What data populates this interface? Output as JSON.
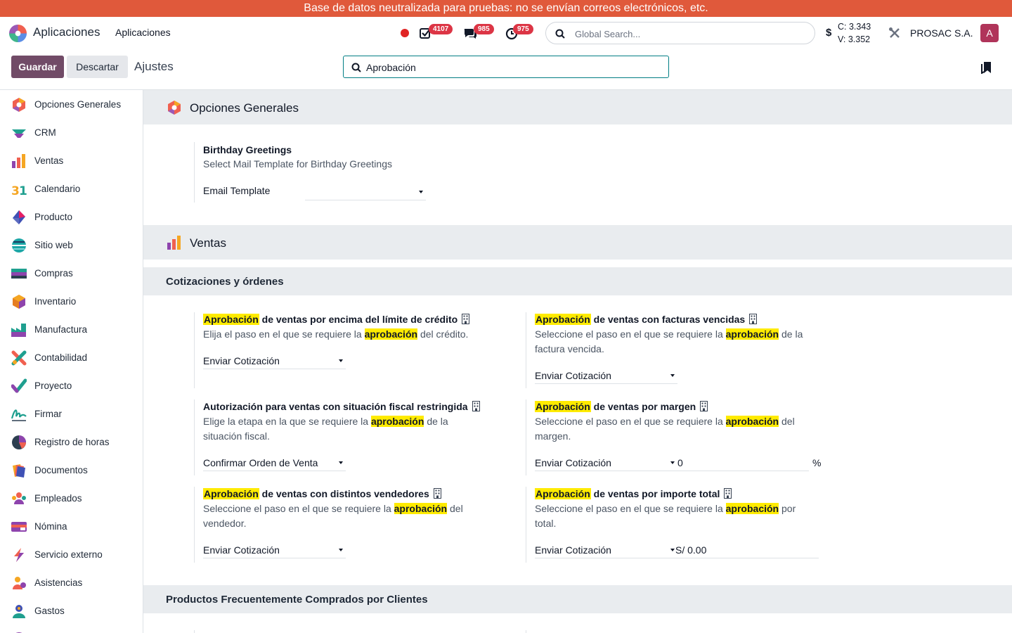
{
  "banner": {
    "text": "Base de datos neutralizada para pruebas: no se envían correos electrónicos, etc."
  },
  "navbar": {
    "app_name": "Aplicaciones",
    "menu_item": "Aplicaciones",
    "activity_badge": "4107",
    "messages_badge": "985",
    "clock_badge": "975",
    "search_placeholder": "Global Search...",
    "currency_symbol": "$",
    "rate_c": "C: 3.343",
    "rate_v": "V: 3.352",
    "company": "PROSAC S.A.",
    "avatar_letter": "A"
  },
  "control_panel": {
    "save_label": "Guardar",
    "discard_label": "Descartar",
    "title": "Ajustes",
    "search_value": "Aprobación"
  },
  "sidebar": {
    "items": [
      {
        "label": "Opciones Generales",
        "icon": "general-settings-icon"
      },
      {
        "label": "CRM",
        "icon": "crm-icon"
      },
      {
        "label": "Ventas",
        "icon": "sales-icon"
      },
      {
        "label": "Calendario",
        "icon": "calendar-icon"
      },
      {
        "label": "Producto",
        "icon": "product-icon"
      },
      {
        "label": "Sitio web",
        "icon": "website-icon"
      },
      {
        "label": "Compras",
        "icon": "purchase-icon"
      },
      {
        "label": "Inventario",
        "icon": "inventory-icon"
      },
      {
        "label": "Manufactura",
        "icon": "manufacturing-icon"
      },
      {
        "label": "Contabilidad",
        "icon": "accounting-icon"
      },
      {
        "label": "Proyecto",
        "icon": "project-icon"
      },
      {
        "label": "Firmar",
        "icon": "sign-icon"
      },
      {
        "label": "Registro de horas",
        "icon": "timesheet-icon"
      },
      {
        "label": "Documentos",
        "icon": "documents-icon"
      },
      {
        "label": "Empleados",
        "icon": "employees-icon"
      },
      {
        "label": "Nómina",
        "icon": "payroll-icon"
      },
      {
        "label": "Servicio externo",
        "icon": "field-service-icon"
      },
      {
        "label": "Asistencias",
        "icon": "attendance-icon"
      },
      {
        "label": "Gastos",
        "icon": "expenses-icon"
      }
    ]
  },
  "general": {
    "title": "Opciones Generales",
    "birthday_title": "Birthday Greetings",
    "birthday_desc": "Select Mail Template for Birthday Greetings",
    "email_template_label": "Email Template",
    "email_template_value": ""
  },
  "sales": {
    "title": "Ventas",
    "section_title": "Cotizaciones y órdenes",
    "next_section_title": "Productos Frecuentemente Comprados por Clientes",
    "hl_word": "Aprobación",
    "hl_word_lower": "aprobación",
    "credit": {
      "title_rest": "de ventas por encima del límite de crédito",
      "desc_pre": "Elija el paso en el que se requiere la",
      "desc_post": "del crédito.",
      "value": "Enviar Cotización"
    },
    "overdue": {
      "title_rest": "de ventas con facturas vencidas",
      "desc_pre": "Seleccione el paso en el que se requiere la",
      "desc_post": "de la factura vencida.",
      "value": "Enviar Cotización"
    },
    "fiscal": {
      "title": "Autorización para ventas con situación fiscal restringida",
      "desc_pre": "Elige la etapa en la que se requiere la",
      "desc_post": "de la situación fiscal.",
      "value": "Confirmar Orden de Venta"
    },
    "margin": {
      "title_rest": "de ventas por margen",
      "desc_pre": "Seleccione el paso en el que se requiere la",
      "desc_post": "del margen.",
      "value": "Enviar Cotización",
      "amount": "0",
      "unit": "%"
    },
    "sellers": {
      "title_rest": "de ventas con distintos vendedores",
      "desc_pre": "Seleccione el paso en el que se requiere la",
      "desc_post": "del vendedor.",
      "value": "Enviar Cotización"
    },
    "total": {
      "title_rest": "de ventas por importe total",
      "desc_pre": "Seleccione el paso en el que se requiere la",
      "desc_post": "por total.",
      "value": "Enviar Cotización",
      "amount": "S/ 0.00"
    }
  }
}
